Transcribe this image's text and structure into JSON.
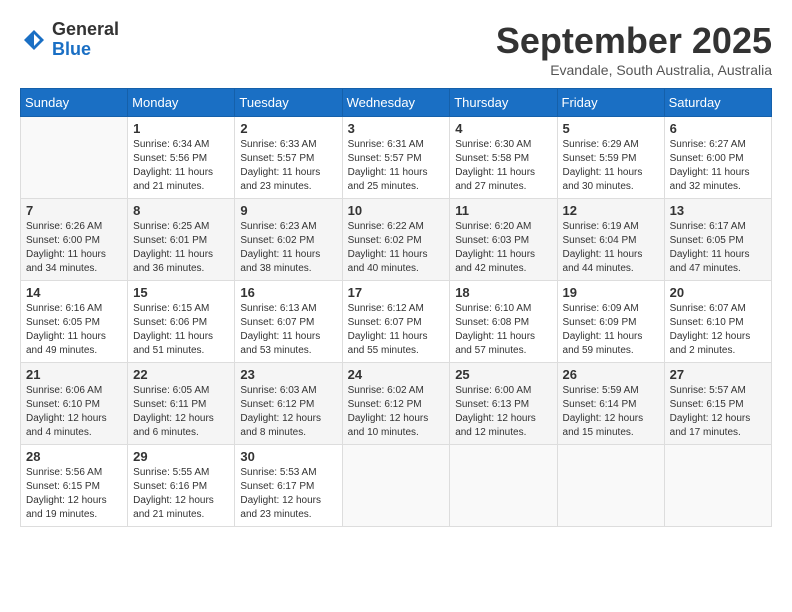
{
  "header": {
    "logo": {
      "general": "General",
      "blue": "Blue"
    },
    "title": "September 2025",
    "subtitle": "Evandale, South Australia, Australia"
  },
  "weekdays": [
    "Sunday",
    "Monday",
    "Tuesday",
    "Wednesday",
    "Thursday",
    "Friday",
    "Saturday"
  ],
  "weeks": [
    [
      {
        "day": "",
        "info": ""
      },
      {
        "day": "1",
        "info": "Sunrise: 6:34 AM\nSunset: 5:56 PM\nDaylight: 11 hours\nand 21 minutes."
      },
      {
        "day": "2",
        "info": "Sunrise: 6:33 AM\nSunset: 5:57 PM\nDaylight: 11 hours\nand 23 minutes."
      },
      {
        "day": "3",
        "info": "Sunrise: 6:31 AM\nSunset: 5:57 PM\nDaylight: 11 hours\nand 25 minutes."
      },
      {
        "day": "4",
        "info": "Sunrise: 6:30 AM\nSunset: 5:58 PM\nDaylight: 11 hours\nand 27 minutes."
      },
      {
        "day": "5",
        "info": "Sunrise: 6:29 AM\nSunset: 5:59 PM\nDaylight: 11 hours\nand 30 minutes."
      },
      {
        "day": "6",
        "info": "Sunrise: 6:27 AM\nSunset: 6:00 PM\nDaylight: 11 hours\nand 32 minutes."
      }
    ],
    [
      {
        "day": "7",
        "info": "Sunrise: 6:26 AM\nSunset: 6:00 PM\nDaylight: 11 hours\nand 34 minutes."
      },
      {
        "day": "8",
        "info": "Sunrise: 6:25 AM\nSunset: 6:01 PM\nDaylight: 11 hours\nand 36 minutes."
      },
      {
        "day": "9",
        "info": "Sunrise: 6:23 AM\nSunset: 6:02 PM\nDaylight: 11 hours\nand 38 minutes."
      },
      {
        "day": "10",
        "info": "Sunrise: 6:22 AM\nSunset: 6:02 PM\nDaylight: 11 hours\nand 40 minutes."
      },
      {
        "day": "11",
        "info": "Sunrise: 6:20 AM\nSunset: 6:03 PM\nDaylight: 11 hours\nand 42 minutes."
      },
      {
        "day": "12",
        "info": "Sunrise: 6:19 AM\nSunset: 6:04 PM\nDaylight: 11 hours\nand 44 minutes."
      },
      {
        "day": "13",
        "info": "Sunrise: 6:17 AM\nSunset: 6:05 PM\nDaylight: 11 hours\nand 47 minutes."
      }
    ],
    [
      {
        "day": "14",
        "info": "Sunrise: 6:16 AM\nSunset: 6:05 PM\nDaylight: 11 hours\nand 49 minutes."
      },
      {
        "day": "15",
        "info": "Sunrise: 6:15 AM\nSunset: 6:06 PM\nDaylight: 11 hours\nand 51 minutes."
      },
      {
        "day": "16",
        "info": "Sunrise: 6:13 AM\nSunset: 6:07 PM\nDaylight: 11 hours\nand 53 minutes."
      },
      {
        "day": "17",
        "info": "Sunrise: 6:12 AM\nSunset: 6:07 PM\nDaylight: 11 hours\nand 55 minutes."
      },
      {
        "day": "18",
        "info": "Sunrise: 6:10 AM\nSunset: 6:08 PM\nDaylight: 11 hours\nand 57 minutes."
      },
      {
        "day": "19",
        "info": "Sunrise: 6:09 AM\nSunset: 6:09 PM\nDaylight: 11 hours\nand 59 minutes."
      },
      {
        "day": "20",
        "info": "Sunrise: 6:07 AM\nSunset: 6:10 PM\nDaylight: 12 hours\nand 2 minutes."
      }
    ],
    [
      {
        "day": "21",
        "info": "Sunrise: 6:06 AM\nSunset: 6:10 PM\nDaylight: 12 hours\nand 4 minutes."
      },
      {
        "day": "22",
        "info": "Sunrise: 6:05 AM\nSunset: 6:11 PM\nDaylight: 12 hours\nand 6 minutes."
      },
      {
        "day": "23",
        "info": "Sunrise: 6:03 AM\nSunset: 6:12 PM\nDaylight: 12 hours\nand 8 minutes."
      },
      {
        "day": "24",
        "info": "Sunrise: 6:02 AM\nSunset: 6:12 PM\nDaylight: 12 hours\nand 10 minutes."
      },
      {
        "day": "25",
        "info": "Sunrise: 6:00 AM\nSunset: 6:13 PM\nDaylight: 12 hours\nand 12 minutes."
      },
      {
        "day": "26",
        "info": "Sunrise: 5:59 AM\nSunset: 6:14 PM\nDaylight: 12 hours\nand 15 minutes."
      },
      {
        "day": "27",
        "info": "Sunrise: 5:57 AM\nSunset: 6:15 PM\nDaylight: 12 hours\nand 17 minutes."
      }
    ],
    [
      {
        "day": "28",
        "info": "Sunrise: 5:56 AM\nSunset: 6:15 PM\nDaylight: 12 hours\nand 19 minutes."
      },
      {
        "day": "29",
        "info": "Sunrise: 5:55 AM\nSunset: 6:16 PM\nDaylight: 12 hours\nand 21 minutes."
      },
      {
        "day": "30",
        "info": "Sunrise: 5:53 AM\nSunset: 6:17 PM\nDaylight: 12 hours\nand 23 minutes."
      },
      {
        "day": "",
        "info": ""
      },
      {
        "day": "",
        "info": ""
      },
      {
        "day": "",
        "info": ""
      },
      {
        "day": "",
        "info": ""
      }
    ]
  ]
}
